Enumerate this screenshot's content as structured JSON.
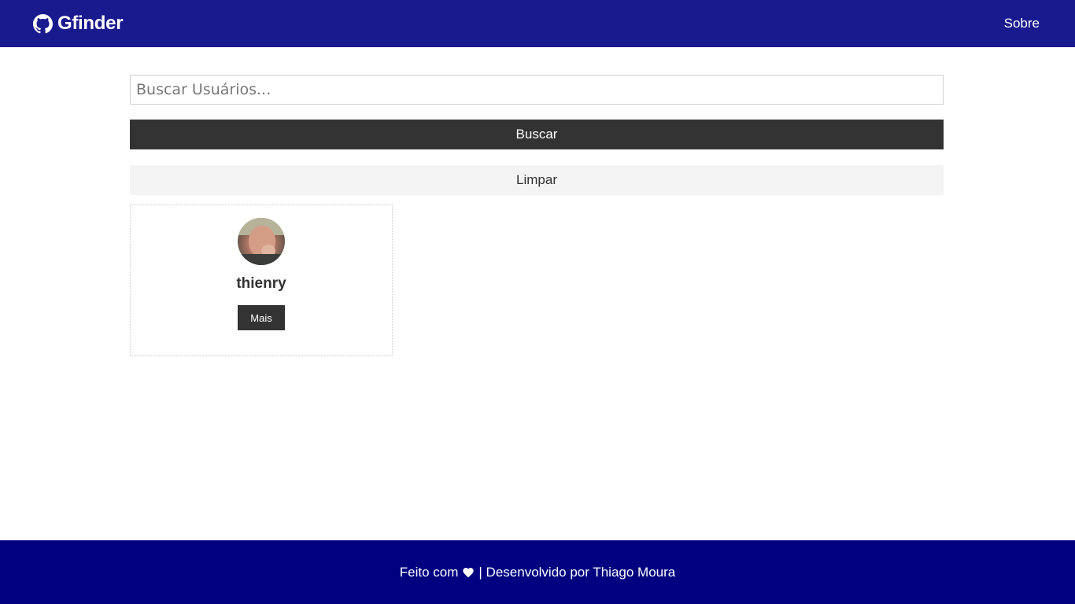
{
  "navbar": {
    "brand_icon": "github-icon",
    "brand_title": "Gfinder",
    "about_link": "Sobre"
  },
  "search": {
    "placeholder": "Buscar Usuários...",
    "value": "",
    "submit_label": "Buscar",
    "clear_label": "Limpar"
  },
  "users": [
    {
      "login": "thienry",
      "avatar": "user-avatar",
      "more_label": "Mais"
    }
  ],
  "footer": {
    "prefix": "Feito com",
    "icon": "heart-icon",
    "suffix": "| Desenvolvido por Thiago Moura"
  },
  "colors": {
    "navbar": "#1a1a8f",
    "footer": "#000080",
    "dark_button": "#333333",
    "light_button": "#f4f4f4"
  }
}
